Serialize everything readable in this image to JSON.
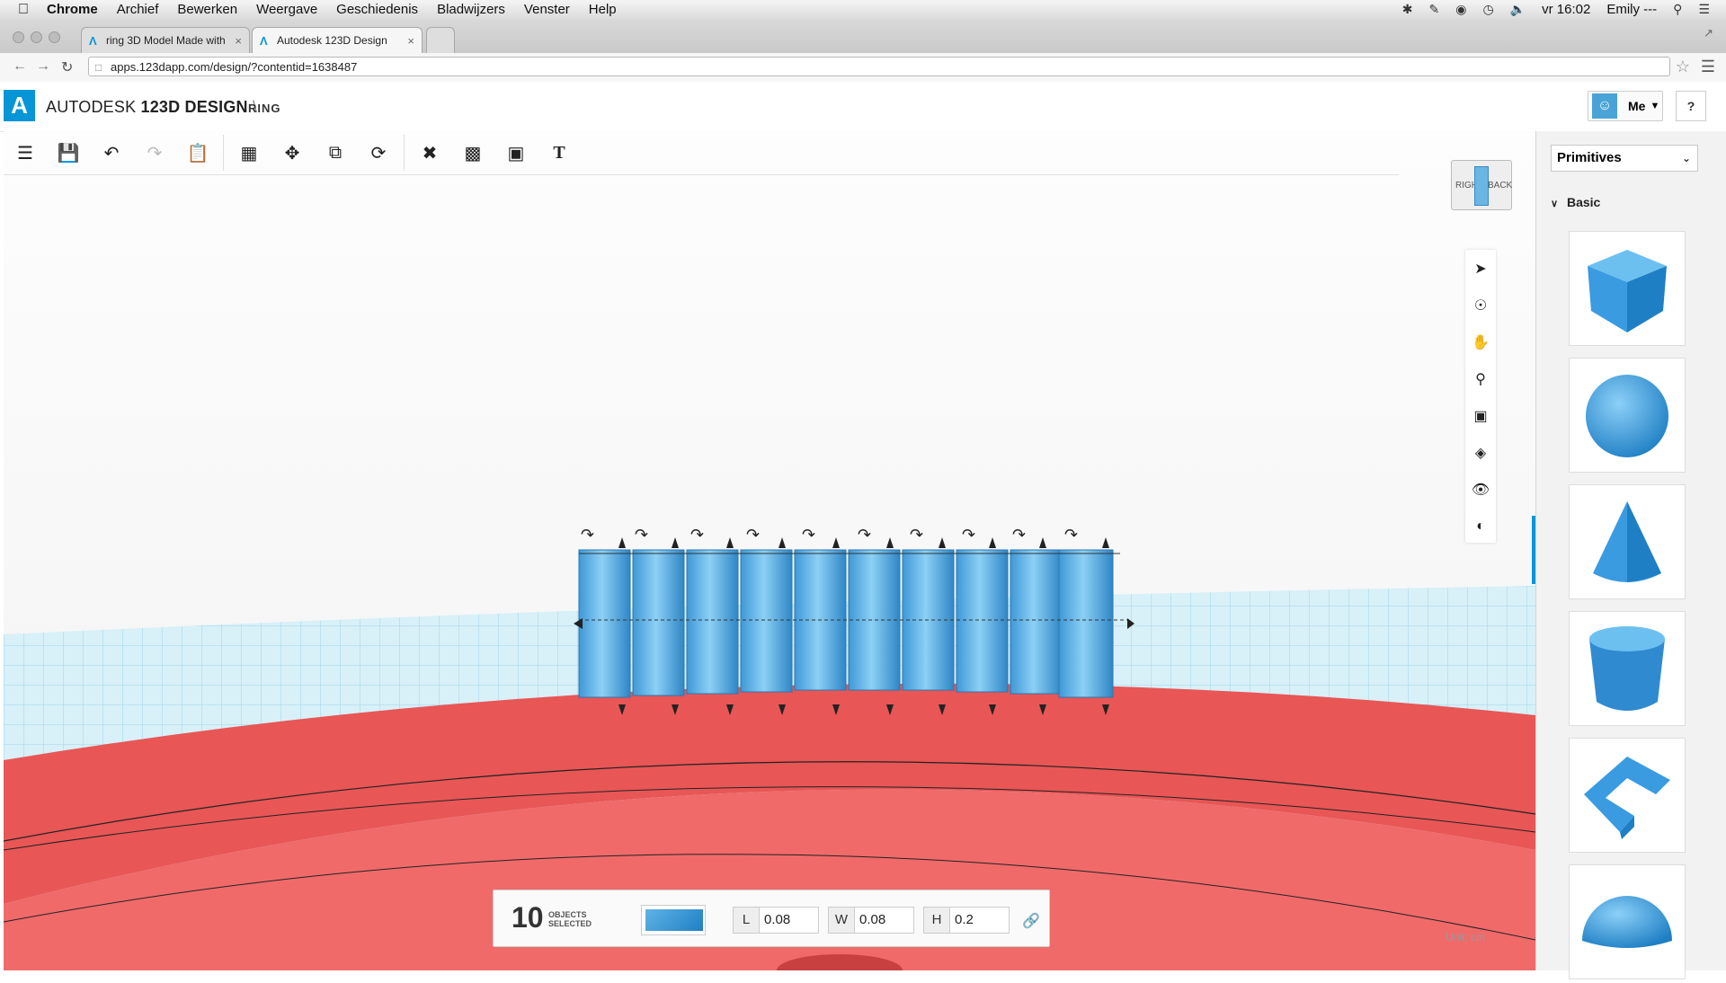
{
  "menubar": {
    "app": "Chrome",
    "items": [
      "Archief",
      "Bewerken",
      "Weergave",
      "Geschiedenis",
      "Bladwijzers",
      "Venster",
      "Help"
    ],
    "clock": "vr 16:02",
    "user": "Emily ---"
  },
  "tabs": [
    {
      "label": "ring 3D Model Made with"
    },
    {
      "label": "Autodesk 123D Design"
    }
  ],
  "address": {
    "url": "apps.123dapp.com/design/?contentid=1638487"
  },
  "header": {
    "brand_prefix": "AUTODESK",
    "brand_main": "123D DESIGN",
    "separator": "\\",
    "project": "RING",
    "user_button": "Me",
    "help": "?"
  },
  "viewcube": {
    "left": "RIGHT",
    "right": "BACK"
  },
  "sidebar": {
    "dropdown": "Primitives",
    "section": "Basic",
    "shapes": [
      "box-icon",
      "sphere-icon",
      "cone-icon",
      "cylinder-icon",
      "wedge-icon",
      "hemisphere-icon"
    ]
  },
  "selection": {
    "count": "10",
    "label_line1": "OBJECTS",
    "label_line2": "SELECTED",
    "L_label": "L",
    "L_value": "0.08",
    "W_label": "W",
    "W_value": "0.08",
    "H_label": "H",
    "H_value": "0.2"
  },
  "units": "Unit:  cm",
  "colors": {
    "accent": "#0696d7",
    "ring": "#e85a5a",
    "shape": "#4fa9e0"
  }
}
